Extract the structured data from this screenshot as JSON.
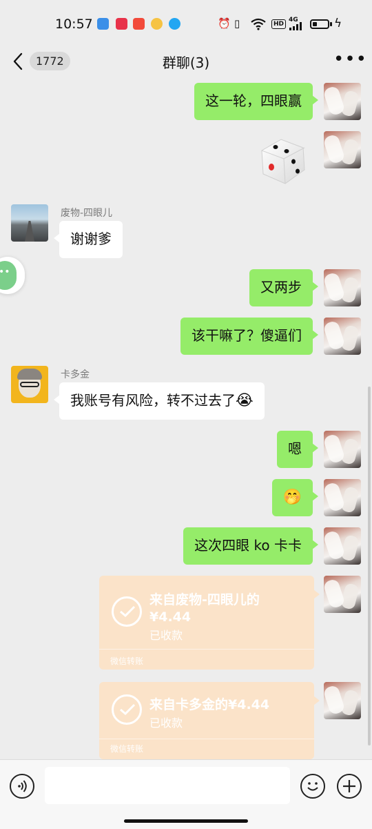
{
  "status_bar": {
    "time": "10:57",
    "network": "4G",
    "hd_label": "HD",
    "app_icons": [
      "bird-app-icon",
      "heart-app-icon",
      "video-app-icon",
      "weibo-app-icon",
      "qq-app-icon"
    ],
    "battery_percent": 20
  },
  "nav": {
    "unread_count": "1772",
    "title": "群聊(3)",
    "more_icon": "more-dots-icon"
  },
  "messages": [
    {
      "type": "text",
      "from": "me",
      "text": "这一轮，四眼赢"
    },
    {
      "type": "dice",
      "from": "me"
    },
    {
      "type": "text",
      "from": "other",
      "sender": "废物-四眼儿",
      "text": "谢谢爹"
    },
    {
      "type": "text",
      "from": "me",
      "text": "又两步"
    },
    {
      "type": "text",
      "from": "me",
      "text": "该干嘛了？傻逼们"
    },
    {
      "type": "text",
      "from": "other",
      "sender": "卡多金",
      "text": "我账号有风险，转不过去了",
      "emoji": "😭"
    },
    {
      "type": "text",
      "from": "me",
      "text": "嗯"
    },
    {
      "type": "emoji",
      "from": "me",
      "emoji": "🤭"
    },
    {
      "type": "text",
      "from": "me",
      "text": "这次四眼 ko 卡卡"
    },
    {
      "type": "transfer",
      "from": "me",
      "title": "来自废物-四眼儿的",
      "amount": "¥4.44",
      "status": "已收款",
      "footer": "微信转账"
    },
    {
      "type": "transfer",
      "from": "me",
      "title": "来自卡多金的¥4.44",
      "status": "已收款",
      "footer": "微信转账"
    }
  ],
  "input": {
    "placeholder": "",
    "voice_icon": "voice-icon",
    "emoji_icon": "emoji-icon",
    "plus_icon": "plus-icon"
  },
  "colors": {
    "my_bubble": "#95ec69",
    "other_bubble": "#ffffff",
    "transfer_card": "#fbe3c9",
    "background": "#ededed"
  }
}
